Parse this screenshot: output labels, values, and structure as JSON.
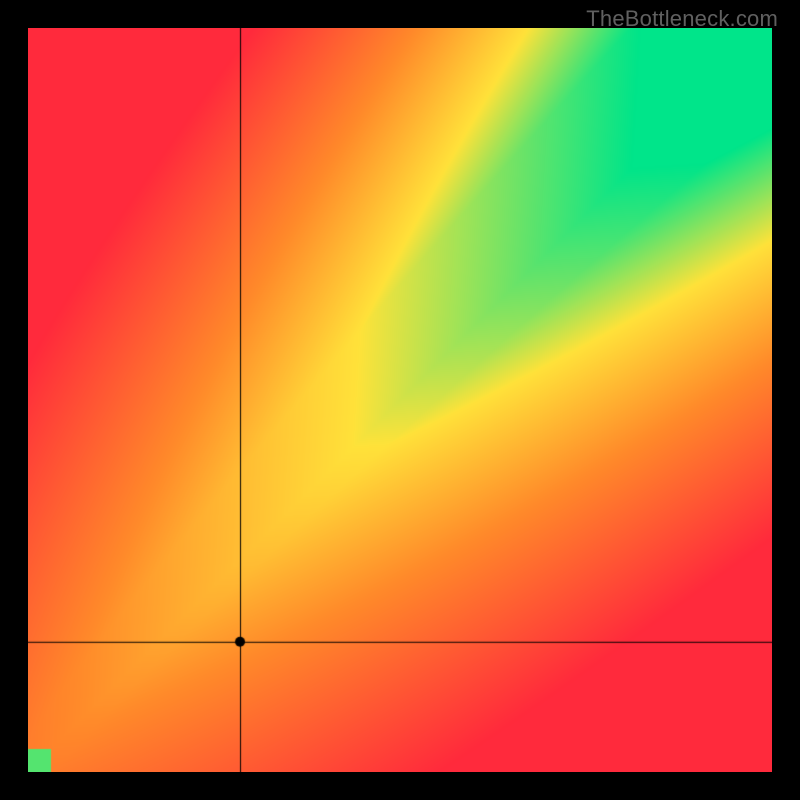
{
  "watermark": "TheBottleneck.com",
  "chart_data": {
    "type": "heatmap",
    "title": "",
    "xlabel": "",
    "ylabel": "",
    "xlim": [
      0,
      100
    ],
    "ylim": [
      0,
      100
    ],
    "heatmap": {
      "description": "Red–orange–yellow–green 2‑D field showing how good a CPU/GPU pairing is. Green runs along the diagonal (more performant pairs toward top‑right), red in the off‑diagonal corners.",
      "optimal_band": {
        "slope": 1.05,
        "thickness_frac": 0.08
      }
    },
    "crosshair": {
      "x_frac": 0.285,
      "y_frac": 0.175
    },
    "marker": {
      "x_frac": 0.285,
      "y_frac": 0.175,
      "radius_px": 5,
      "color": "#000000"
    },
    "colors": {
      "red": "#ff2a3c",
      "orange": "#ff8a2a",
      "yellow": "#ffe23a",
      "green": "#00e58a"
    },
    "border_px": 28,
    "border_color": "#000000"
  }
}
